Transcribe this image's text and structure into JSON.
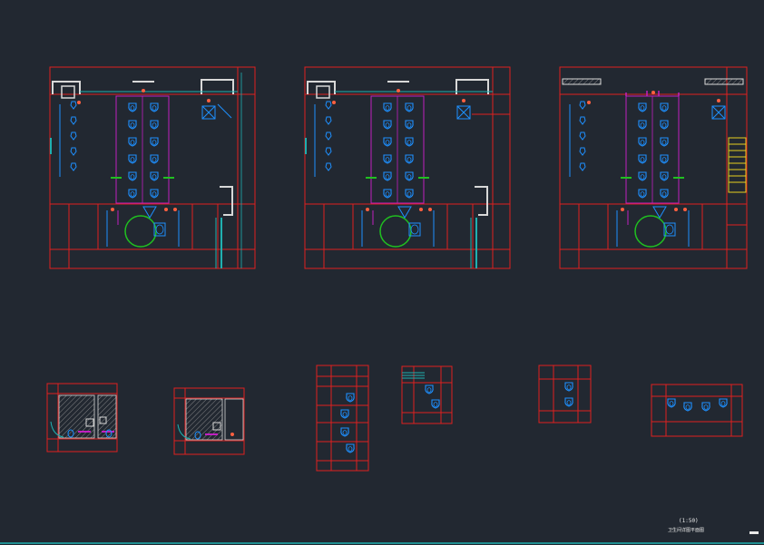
{
  "colors": {
    "background": "#222831",
    "grid": "#e02020",
    "fixture": "#1e90ff",
    "partition": "#c020c0",
    "wall": "#d8d8d8",
    "pipe": "#20b0b0",
    "door": "#20c020",
    "stair": "#e8d020",
    "accent": "#ff6040"
  },
  "icons": {
    "toilet": "toilet-icon",
    "urinal": "urinal-icon",
    "floor-drain": "floor-drain-icon",
    "door-swing": "door-swing-arc"
  },
  "title_block": {
    "scale_label": "(1:50)",
    "drawing_name": "卫生间详图平面图"
  }
}
